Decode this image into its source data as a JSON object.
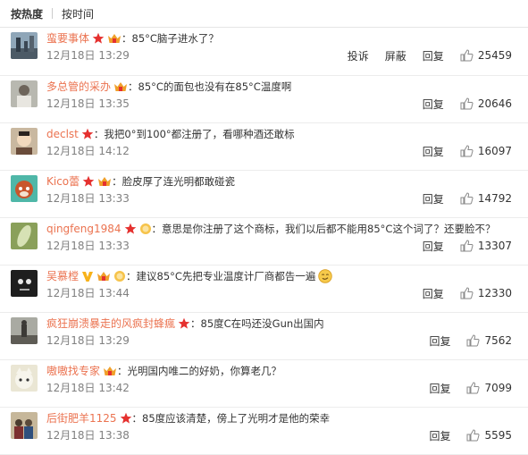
{
  "tabs": [
    {
      "label": "按热度",
      "active": true
    },
    {
      "label": "按时间",
      "active": false
    }
  ],
  "labels": {
    "report": "投诉",
    "block": "屏蔽",
    "reply": "回复"
  },
  "colors": {
    "username": "#eb7350",
    "star_badge": "#e5312f",
    "vip_v": "#f7b21a",
    "member_crown": "#f0a02a"
  },
  "comments": [
    {
      "user": "蛮要事体",
      "badges": [
        "star-badge",
        "member-crown-badge"
      ],
      "text": "：85°C脑子进水了？",
      "time": "12月18日 13:29",
      "report": true,
      "block": true,
      "likes": "25459",
      "avatar": "city-photo"
    },
    {
      "user": "多总管的采办",
      "badges": [
        "member-crown-badge"
      ],
      "text": "：85°C的面包也没有在85°C温度啊",
      "time": "12月18日 13:35",
      "report": false,
      "block": false,
      "likes": "20646",
      "avatar": "person-photo"
    },
    {
      "user": "declst",
      "badges": [
        "star-badge"
      ],
      "text": "：我把0°到100°都注册了，看哪种酒还敢标",
      "time": "12月18日 14:12",
      "report": false,
      "block": false,
      "likes": "16097",
      "avatar": "portrait-photo"
    },
    {
      "user": "Kico蕾",
      "badges": [
        "star-badge",
        "member-crown-badge"
      ],
      "text": "：脸皮厚了连光明都敢碰瓷",
      "time": "12月18日 13:33",
      "report": false,
      "block": false,
      "likes": "14792",
      "avatar": "red-panda-cartoon"
    },
    {
      "user": "qingfeng1984",
      "badges": [
        "star-badge",
        "medal-badge"
      ],
      "text": "：意思是你注册了这个商标，我们以后都不能用85°C这个词了？还要脸不？",
      "time": "12月18日 13:33",
      "report": false,
      "block": false,
      "likes": "13307",
      "avatar": "leaf-photo"
    },
    {
      "user": "吴慕樘",
      "badges": [
        "vip-v-badge",
        "member-crown-badge",
        "medal-badge"
      ],
      "text": "：建议85°C先把专业温度计厂商都告一遍",
      "emoji": "smirk-emoji",
      "time": "12月18日 13:44",
      "report": false,
      "block": false,
      "likes": "12330",
      "avatar": "dark-face-photo"
    },
    {
      "user": "疯狂崩溃暴走的风疯封蜂瘋",
      "badges": [
        "star-badge"
      ],
      "text": "：85度C在吗还没Gun出国内",
      "time": "12月18日 13:29",
      "report": false,
      "block": false,
      "likes": "7562",
      "avatar": "street-photo"
    },
    {
      "user": "嗷嗷找专家",
      "badges": [
        "member-crown-badge"
      ],
      "text": "：光明国内唯二的好奶，你算老几？",
      "time": "12月18日 13:42",
      "report": false,
      "block": false,
      "likes": "7099",
      "avatar": "anime-cat"
    },
    {
      "user": "后街肥羊1125",
      "badges": [
        "star-badge"
      ],
      "text": "：85度应该清楚，傍上了光明才是他的荣幸",
      "time": "12月18日 13:38",
      "report": false,
      "block": false,
      "likes": "5595",
      "avatar": "group-photo"
    }
  ]
}
